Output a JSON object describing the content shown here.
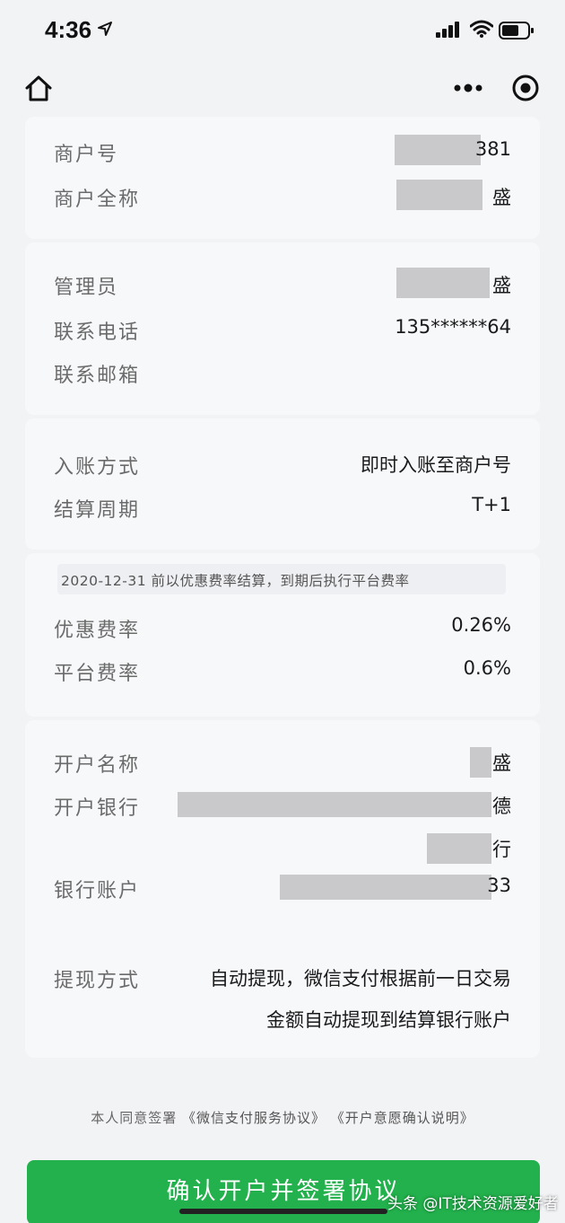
{
  "status_bar": {
    "time": "4:36"
  },
  "merchant": {
    "merchant_id_label": "商户号",
    "merchant_id_value": "381",
    "full_name_label": "商户全称",
    "full_name_value": "盛"
  },
  "contact": {
    "admin_label": "管理员",
    "admin_value": "盛",
    "phone_label": "联系电话",
    "phone_value": "135******64",
    "email_label": "联系邮箱",
    "email_value": ""
  },
  "settlement": {
    "method_label": "入账方式",
    "method_value": "即时入账至商户号",
    "cycle_label": "结算周期",
    "cycle_value": "T+1"
  },
  "rates": {
    "notice": "2020-12-31 前以优惠费率结算，到期后执行平台费率",
    "promo_label": "优惠费率",
    "promo_value": "0.26%",
    "platform_label": "平台费率",
    "platform_value": "0.6%"
  },
  "bank": {
    "account_name_label": "开户名称",
    "account_name_value": "盛",
    "bank_label": "开户银行",
    "bank_value_line1": "德",
    "bank_value_line2": "行",
    "account_no_label": "银行账户",
    "account_no_value": "33",
    "withdraw_label": "提现方式",
    "withdraw_line1": "自动提现，微信支付根据前一日交易",
    "withdraw_line2": "金额自动提现到结算银行账户"
  },
  "agreement": {
    "prefix": "本人同意签署",
    "link1": "《微信支付服务协议》",
    "link2": "《开户意愿确认说明》"
  },
  "actions": {
    "confirm_label": "确认开户并签署协议"
  },
  "watermark": "头条 @IT技术资源爱好者",
  "colors": {
    "primary_green": "#22b14c",
    "page_bg": "#f2f3f5",
    "mask_gray": "#c9c9cc"
  }
}
